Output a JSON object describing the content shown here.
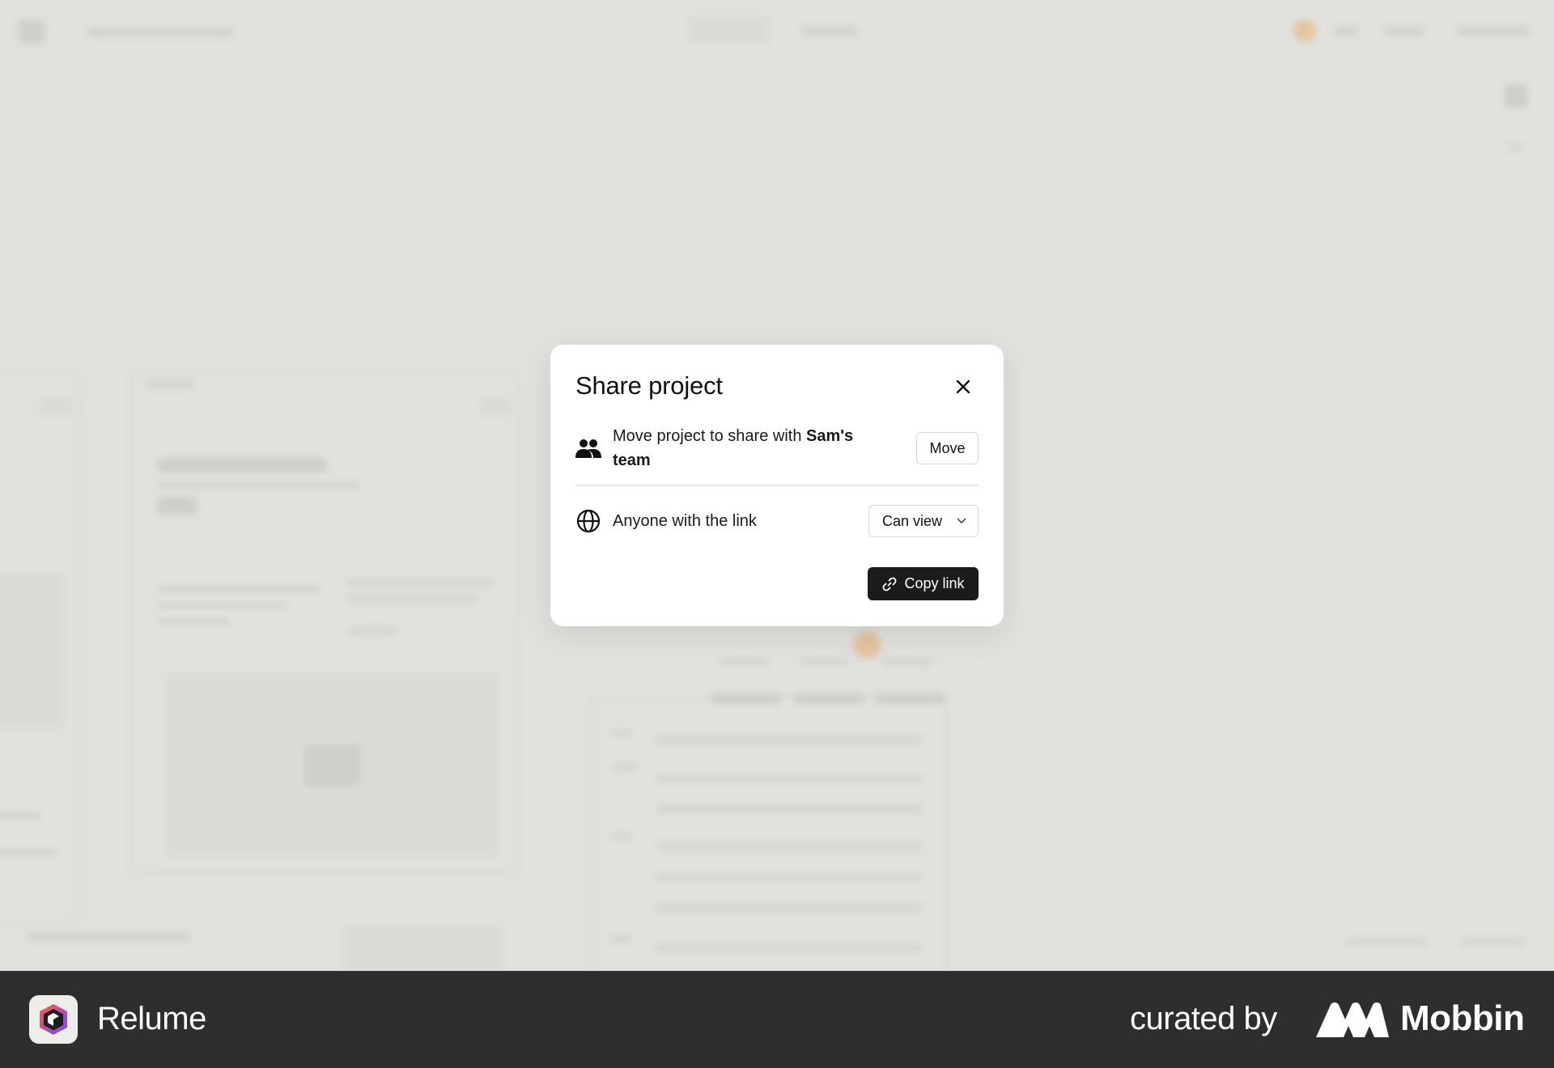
{
  "modal": {
    "title": "Share project",
    "move_row": {
      "text_prefix": "Move project to share with ",
      "team_name": "Sam's",
      "team_suffix": "team",
      "button_label": "Move",
      "icon": "users-icon"
    },
    "link_row": {
      "text": "Anyone with the link",
      "permission_selected": "Can view",
      "icon": "globe-icon"
    },
    "copy_button_label": "Copy link",
    "close_icon": "close-icon"
  },
  "footer": {
    "brand_name": "Relume",
    "curated_label": "curated by",
    "curator_name": "Mobbin"
  },
  "colors": {
    "primary_button": "#1b1b1b",
    "footer_bg": "#2e2e2e",
    "overlay_bg": "#e6e5e3"
  }
}
